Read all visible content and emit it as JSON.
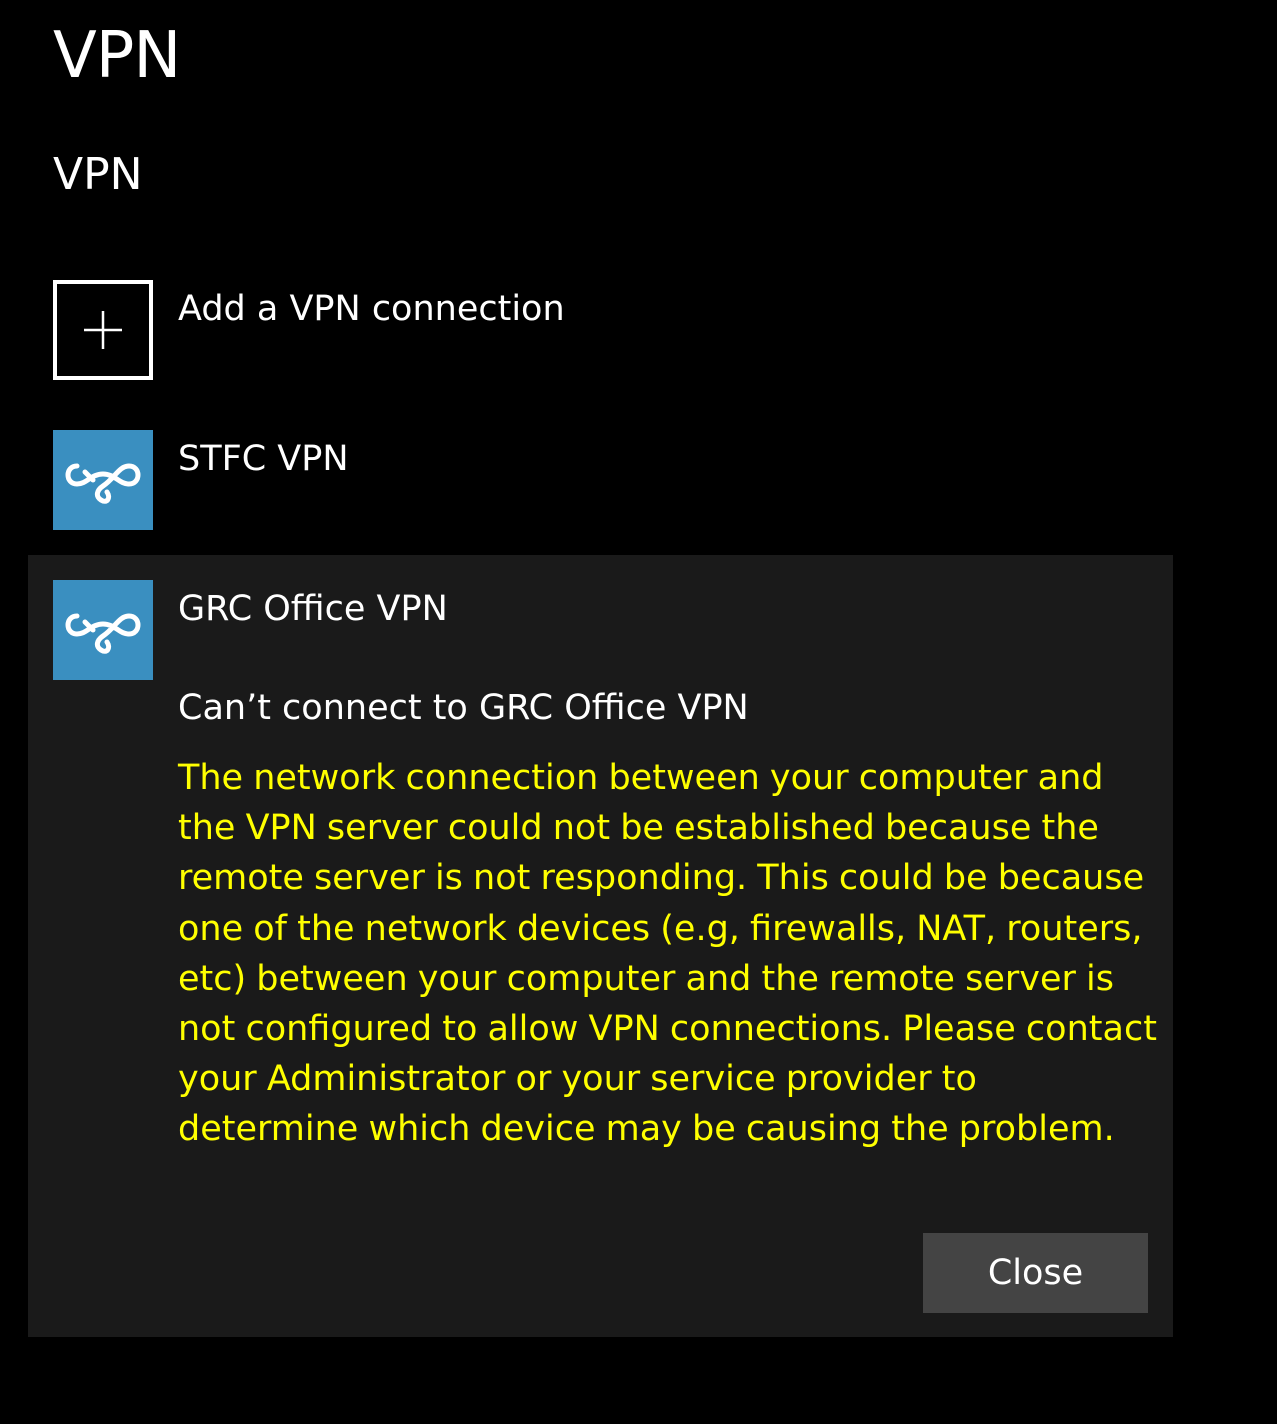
{
  "page": {
    "title": "VPN"
  },
  "section": {
    "title": "VPN"
  },
  "add_connection": {
    "label": "Add a VPN connection",
    "icon": "plus-icon"
  },
  "connections": [
    {
      "name": "STFC VPN",
      "icon": "vpn-icon"
    },
    {
      "name": "GRC Office VPN",
      "icon": "vpn-icon",
      "expanded": true,
      "error": {
        "title": "Can’t connect to GRC Office VPN",
        "message": "The network connection between your computer and the VPN server could not be established because the remote server is not responding. This could be because one of the network devices (e.g, firewalls, NAT, routers, etc) between your computer and the remote server is not configured to allow VPN connections. Please contact your Administrator or your service provider to determine which device may be causing the problem."
      },
      "close_label": "Close"
    }
  ],
  "colors": {
    "background": "#000000",
    "panel": "#1a1a1a",
    "tile_blue": "#3a8fc0",
    "error_text": "#ffff00",
    "button": "#444444"
  }
}
